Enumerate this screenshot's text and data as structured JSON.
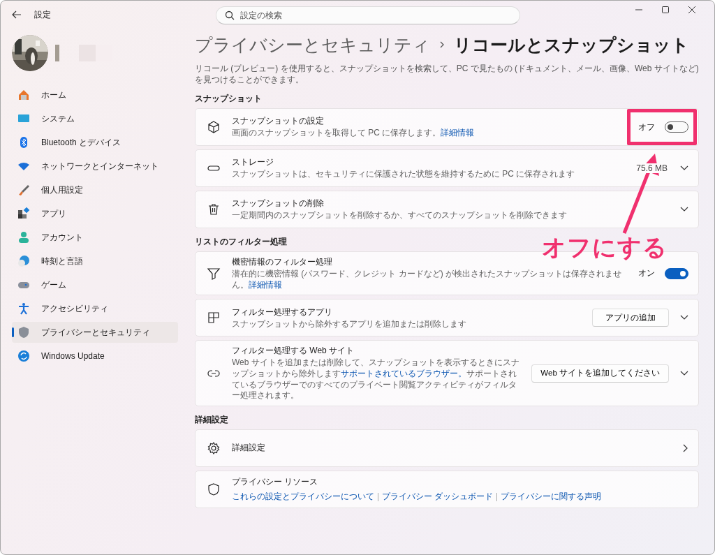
{
  "window": {
    "title": "設定"
  },
  "search": {
    "placeholder": "設定の検索"
  },
  "sidebar": {
    "items": [
      {
        "label": "ホーム",
        "selected": false
      },
      {
        "label": "システム",
        "selected": false
      },
      {
        "label": "Bluetooth とデバイス",
        "selected": false
      },
      {
        "label": "ネットワークとインターネット",
        "selected": false
      },
      {
        "label": "個人用設定",
        "selected": false
      },
      {
        "label": "アプリ",
        "selected": false
      },
      {
        "label": "アカウント",
        "selected": false
      },
      {
        "label": "時刻と言語",
        "selected": false
      },
      {
        "label": "ゲーム",
        "selected": false
      },
      {
        "label": "アクセシビリティ",
        "selected": false
      },
      {
        "label": "プライバシーとセキュリティ",
        "selected": true
      },
      {
        "label": "Windows Update",
        "selected": false
      }
    ]
  },
  "breadcrumb": {
    "parent": "プライバシーとセキュリティ",
    "current": "リコールとスナップショット"
  },
  "description": "リコール (プレビュー) を使用すると、スナップショットを検索して、PC で見たもの (ドキュメント、メール、画像、Web サイトなど) を見つけることができます。",
  "sections": [
    {
      "heading": "スナップショット",
      "rows": [
        {
          "kind": "toggle",
          "title": "スナップショットの設定",
          "desc": "画面のスナップショットを取得して PC に保存します。",
          "link": "詳細情報",
          "toggle_label": "オフ",
          "on": false,
          "highlighted": true
        },
        {
          "kind": "expander",
          "title": "ストレージ",
          "desc": "スナップショットは、セキュリティに保護された状態を維持するために PC に保存されます",
          "value": "75.6 MB"
        },
        {
          "kind": "expander",
          "title": "スナップショットの削除",
          "desc": "一定期間内のスナップショットを削除するか、すべてのスナップショットを削除できます"
        }
      ]
    },
    {
      "heading": "リストのフィルター処理",
      "rows": [
        {
          "kind": "toggle",
          "title": "機密情報のフィルター処理",
          "desc": "潜在的に機密情報 (パスワード、クレジット カードなど) が検出されたスナップショットは保存されません。",
          "link": "詳細情報",
          "toggle_label": "オン",
          "on": true,
          "highlighted": false
        },
        {
          "kind": "button",
          "title": "フィルター処理するアプリ",
          "desc": "スナップショットから除外するアプリを追加または削除します",
          "button": "アプリの追加"
        },
        {
          "kind": "button",
          "title": "フィルター処理する Web サイト",
          "desc": "Web サイトを追加または削除して、スナップショットを表示するときにスナップショットから除外します",
          "link": "サポートされているブラウザー。",
          "desc_after": "サポートされているブラウザーでのすべてのプライベート閲覧アクティビティがフィルター処理されます。",
          "button": "Web サイトを追加してください"
        }
      ]
    },
    {
      "heading": "詳細設定",
      "rows": [
        {
          "kind": "nav",
          "title": "詳細設定"
        },
        {
          "kind": "links",
          "title": "プライバシー リソース",
          "links": [
            "これらの設定とプライバシーについて",
            "プライバシー ダッシュボード",
            "プライバシーに関する声明"
          ]
        }
      ]
    }
  ],
  "annotation": {
    "text": "オフにする"
  }
}
